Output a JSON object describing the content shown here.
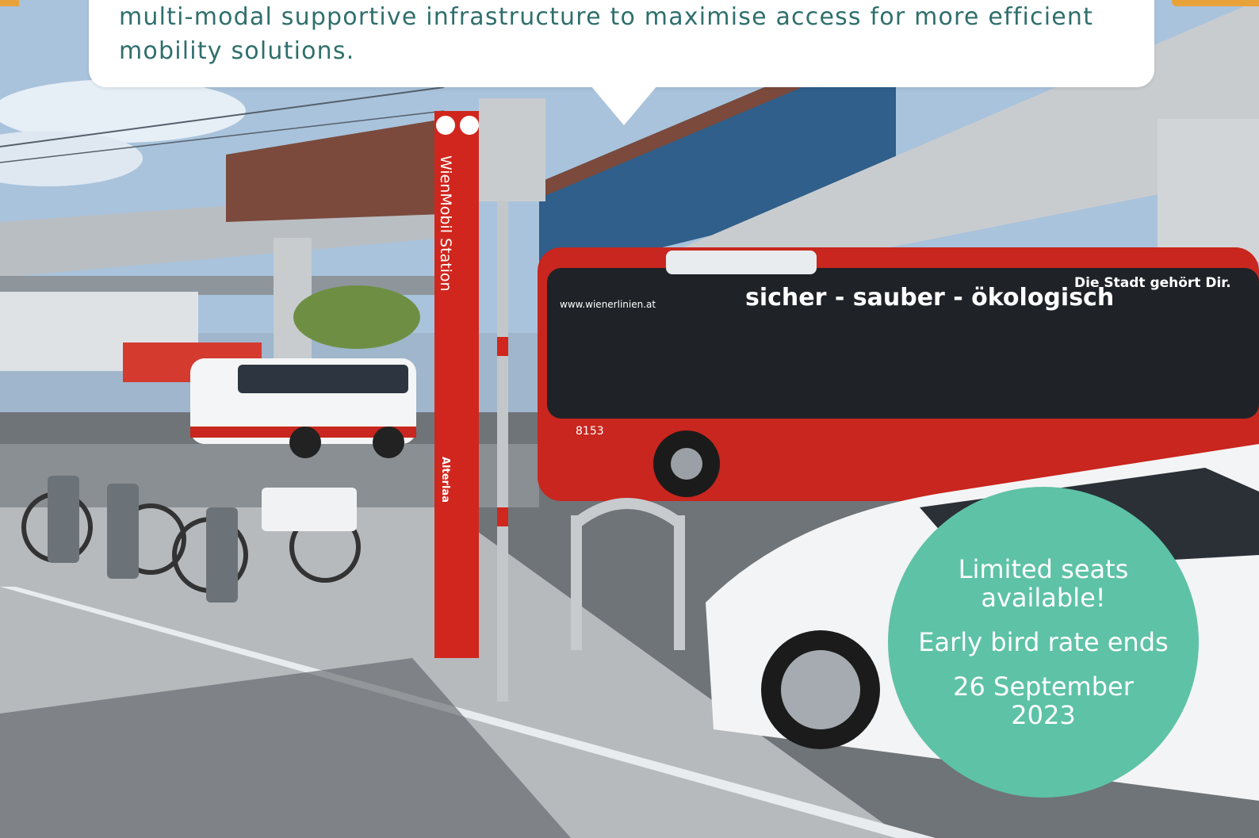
{
  "speech": {
    "text": "multi-modal supportive infrastructure to maximise access for more efficient mobility solutions."
  },
  "scene": {
    "sign_vertical": "WienMobil Station",
    "sign_stop": "Alterlaa",
    "bus_slogan": "sicher - sauber - ökologisch",
    "bus_tagline": "Die Stadt gehört Dir.",
    "bus_url": "www.wienerlinien.at",
    "bus_number": "8153"
  },
  "promo": {
    "line1": "Limited seats",
    "line2": "available!",
    "line3": "Early bird rate ends",
    "line4": "26 September",
    "line5": "2023"
  },
  "colors": {
    "accent_orange": "#e8a23a",
    "promo_teal": "#5ec2a6",
    "text_teal": "#2f6f6c",
    "bus_red": "#c8261e"
  }
}
